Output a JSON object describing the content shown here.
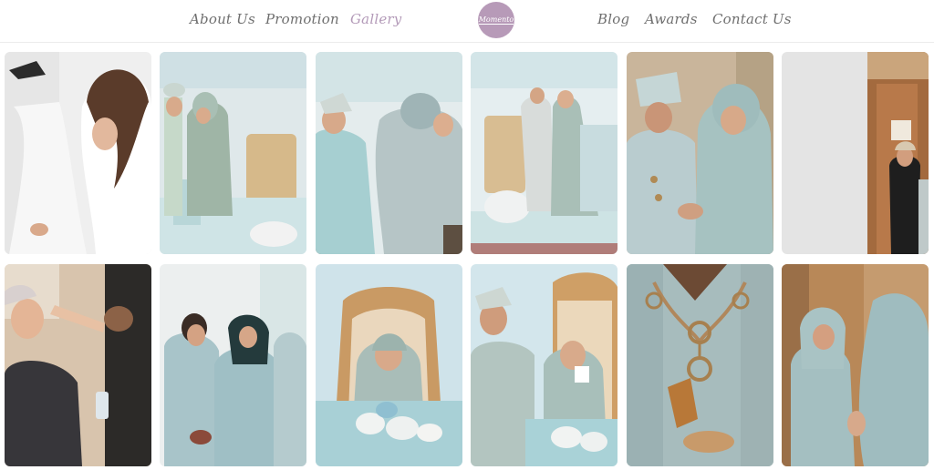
{
  "nav": {
    "about": "About Us",
    "promotion": "Promotion",
    "gallery": "Gallery",
    "logo": "Momento",
    "blog": "Blog",
    "awards": "Awards",
    "contact": "Contact Us"
  },
  "colors": {
    "nav_text": "#6f6f6f",
    "nav_active": "#b39ab8",
    "logo_bg": "#b79ab8"
  },
  "gallery": {
    "photos": [
      {
        "subject": "bride-dress-hanging"
      },
      {
        "subject": "couple-at-dais"
      },
      {
        "subject": "couple-embrace"
      },
      {
        "subject": "couple-standing-dais"
      },
      {
        "subject": "ring-exchange"
      },
      {
        "subject": "bride-by-door"
      },
      {
        "subject": "bride-makeup"
      },
      {
        "subject": "bridesmaids-smiling"
      },
      {
        "subject": "bride-on-throne"
      },
      {
        "subject": "couple-seated-throne"
      },
      {
        "subject": "groom-outfit-detail"
      },
      {
        "subject": "bride-in-mirror"
      }
    ]
  }
}
